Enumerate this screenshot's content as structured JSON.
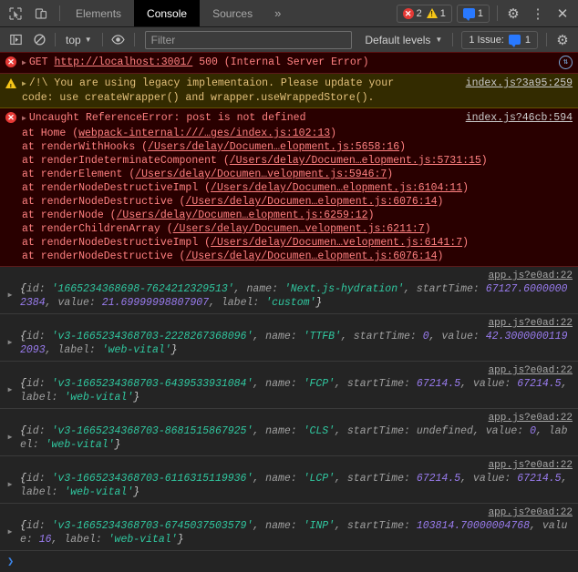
{
  "tabbar": {
    "icons": [
      {
        "name": "inspect-element-icon"
      },
      {
        "name": "device-toolbar-icon"
      }
    ],
    "tabs": [
      {
        "label": "Elements",
        "active": false
      },
      {
        "label": "Console",
        "active": true
      },
      {
        "label": "Sources",
        "active": false
      }
    ],
    "more_label": "»",
    "error_count": "2",
    "warning_count": "1",
    "message_count": "1",
    "settings_label": "⚙",
    "kebab_label": "⋮",
    "close_label": "✕"
  },
  "filterbar": {
    "sidebar_toggle": "sidebar-toggle-icon",
    "clear_console": "clear-console-icon",
    "context_label": "top",
    "eye_label": "eye-icon",
    "filter_value": "",
    "filter_placeholder": "Filter",
    "levels_label": "Default levels",
    "issues_label": "1 Issue:",
    "issues_count": "1",
    "settings_label": "⚙"
  },
  "console": {
    "network_error": {
      "method": "GET",
      "url": "http://localhost:3001/",
      "status": "500 (Internal Server Error)",
      "network_icon": "network-request-icon"
    },
    "warning": {
      "line1": "/!\\ You are using legacy implementaion. Please update your",
      "line2": "code: use createWrapper() and wrapper.useWrappedStore().",
      "source": "index.js?3a95:259"
    },
    "uncaught": {
      "message": "Uncaught ReferenceError: post is not defined",
      "source": "index.js?46cb:594",
      "stack": [
        {
          "fn": "at Home",
          "loc": "webpack-internal:///…ges/index.js:102:13"
        },
        {
          "fn": "at renderWithHooks",
          "loc": "/Users/delay/Documen…elopment.js:5658:16"
        },
        {
          "fn": "at renderIndeterminateComponent",
          "loc": "/Users/delay/Documen…elopment.js:5731:15"
        },
        {
          "fn": "at renderElement",
          "loc": "/Users/delay/Documen…velopment.js:5946:7"
        },
        {
          "fn": "at renderNodeDestructiveImpl",
          "loc": "/Users/delay/Documen…elopment.js:6104:11"
        },
        {
          "fn": "at renderNodeDestructive",
          "loc": "/Users/delay/Documen…elopment.js:6076:14"
        },
        {
          "fn": "at renderNode",
          "loc": "/Users/delay/Documen…elopment.js:6259:12"
        },
        {
          "fn": "at renderChildrenArray",
          "loc": "/Users/delay/Documen…velopment.js:6211:7"
        },
        {
          "fn": "at renderNodeDestructiveImpl",
          "loc": "/Users/delay/Documen…velopment.js:6141:7"
        },
        {
          "fn": "at renderNodeDestructive",
          "loc": "/Users/delay/Documen…elopment.js:6076:14"
        }
      ]
    },
    "objects": [
      {
        "source": "app.js?e0ad:22",
        "id": "1665234368698-7624212329513",
        "name": "Next.js-hydration",
        "startTime": "67127.60000002384",
        "value": "21.69999998807907",
        "label": "custom"
      },
      {
        "source": "app.js?e0ad:22",
        "id": "v3-1665234368703-2228267368096",
        "name": "TTFB",
        "startTime": "0",
        "value": "42.30000001192093",
        "label": "web-vital"
      },
      {
        "source": "app.js?e0ad:22",
        "id": "v3-1665234368703-6439533931084",
        "name": "FCP",
        "startTime": "67214.5",
        "value": "67214.5",
        "label": "web-vital"
      },
      {
        "source": "app.js?e0ad:22",
        "id": "v3-1665234368703-8681515867925",
        "name": "CLS",
        "startTime": "undefined",
        "value": "0",
        "label": "web-vital"
      },
      {
        "source": "app.js?e0ad:22",
        "id": "v3-1665234368703-6116315119936",
        "name": "LCP",
        "startTime": "67214.5",
        "value": "67214.5",
        "label": "web-vital"
      },
      {
        "source": "app.js?e0ad:22",
        "id": "v3-1665234368703-6745037503579",
        "name": "INP",
        "startTime": "103814.70000004768",
        "value": "16",
        "label": "web-vital"
      }
    ],
    "prompt": "❯"
  },
  "colors": {
    "error_bg": "#290000",
    "warn_bg": "#332b00",
    "error_text": "#ff8080",
    "warn_text": "#e3c07b",
    "string": "#30c8a0",
    "number": "#9a7cf0",
    "accent_blue": "#2979ff"
  }
}
